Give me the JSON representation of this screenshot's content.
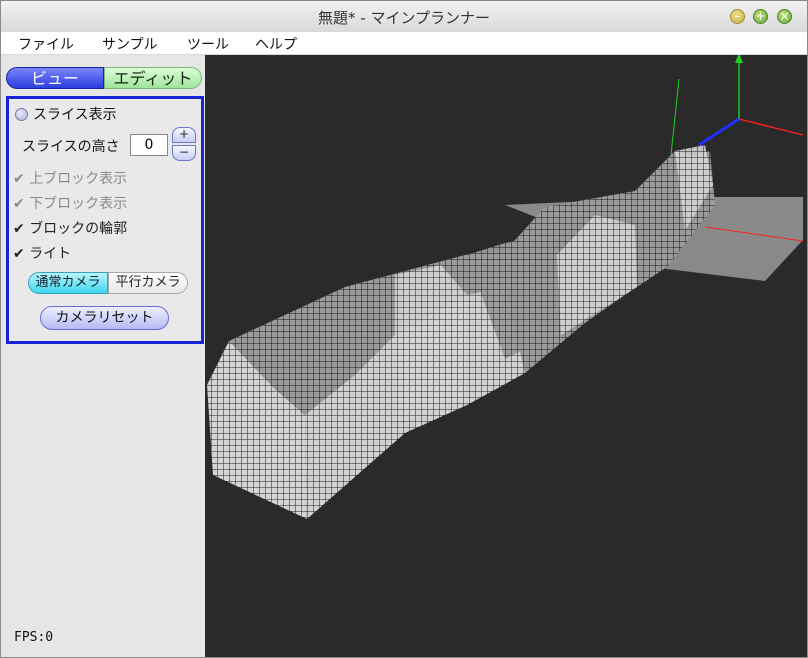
{
  "window": {
    "title": "無題* - マインプランナー"
  },
  "menu": [
    {
      "label": "ファイル"
    },
    {
      "label": "サンプル"
    },
    {
      "label": "ツール"
    },
    {
      "label": "ヘルプ"
    }
  ],
  "mode_tabs": {
    "view": "ビュー",
    "edit": "エディット",
    "selected": "view"
  },
  "panel": {
    "slice_toggle": "スライス表示",
    "slice_height_label": "スライスの高さ",
    "slice_height_value": "0",
    "plus": "+",
    "minus": "−",
    "upper_block_label": "上ブロック表示",
    "lower_block_label": "下ブロック表示",
    "outline_label": "ブロックの輪郭",
    "light_label": "ライト",
    "camera_normal": "通常カメラ",
    "camera_parallel": "平行カメラ",
    "camera_reset": "カメラリセット",
    "check_mark": "✔"
  },
  "status": {
    "fps": "FPS:0"
  },
  "colors": {
    "accent_blue": "#1a22d8",
    "viewport_bg": "#2a2a2a",
    "axis_x": "#ff2020",
    "axis_y": "#20d020",
    "axis_z": "#2030ff"
  }
}
